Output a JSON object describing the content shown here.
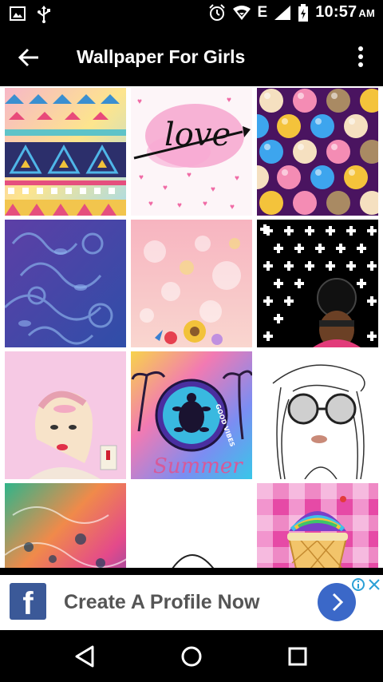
{
  "status_bar": {
    "time": "10:57",
    "ampm": "AM",
    "icons": [
      "image-icon",
      "usb-icon",
      "alarm-icon",
      "wifi-icon",
      "lte-icon",
      "signal-icon",
      "battery-charging-icon"
    ],
    "network_label": "E"
  },
  "app_bar": {
    "title": "Wallpaper For Girls",
    "back_icon": "arrow-left-icon",
    "menu_icon": "more-vertical-icon"
  },
  "wallpapers": [
    {
      "name": "tribal-aztec-pattern"
    },
    {
      "name": "love-watercolor-hearts",
      "text": "love"
    },
    {
      "name": "colorful-balls"
    },
    {
      "name": "purple-blue-floral-swirls"
    },
    {
      "name": "pink-bokeh-flowers"
    },
    {
      "name": "black-white-cross-pattern-girl"
    },
    {
      "name": "pinup-girl-lipstick"
    },
    {
      "name": "summer-turtle-good-vibes",
      "text": "GOOD VIBES",
      "script": "Summer"
    },
    {
      "name": "sketch-girl-sunglasses"
    },
    {
      "name": "rainbow-floral-gradient"
    },
    {
      "name": "sketch-girl-partial"
    },
    {
      "name": "icecream-pink-gingham"
    }
  ],
  "ad": {
    "headline": "Create A Profile Now",
    "brand_icon": "facebook-icon",
    "accent": "#3b5998",
    "cta_color": "#3b68c8"
  },
  "nav_bar": {
    "buttons": [
      "back-triangle-icon",
      "home-circle-icon",
      "recents-square-icon"
    ]
  }
}
